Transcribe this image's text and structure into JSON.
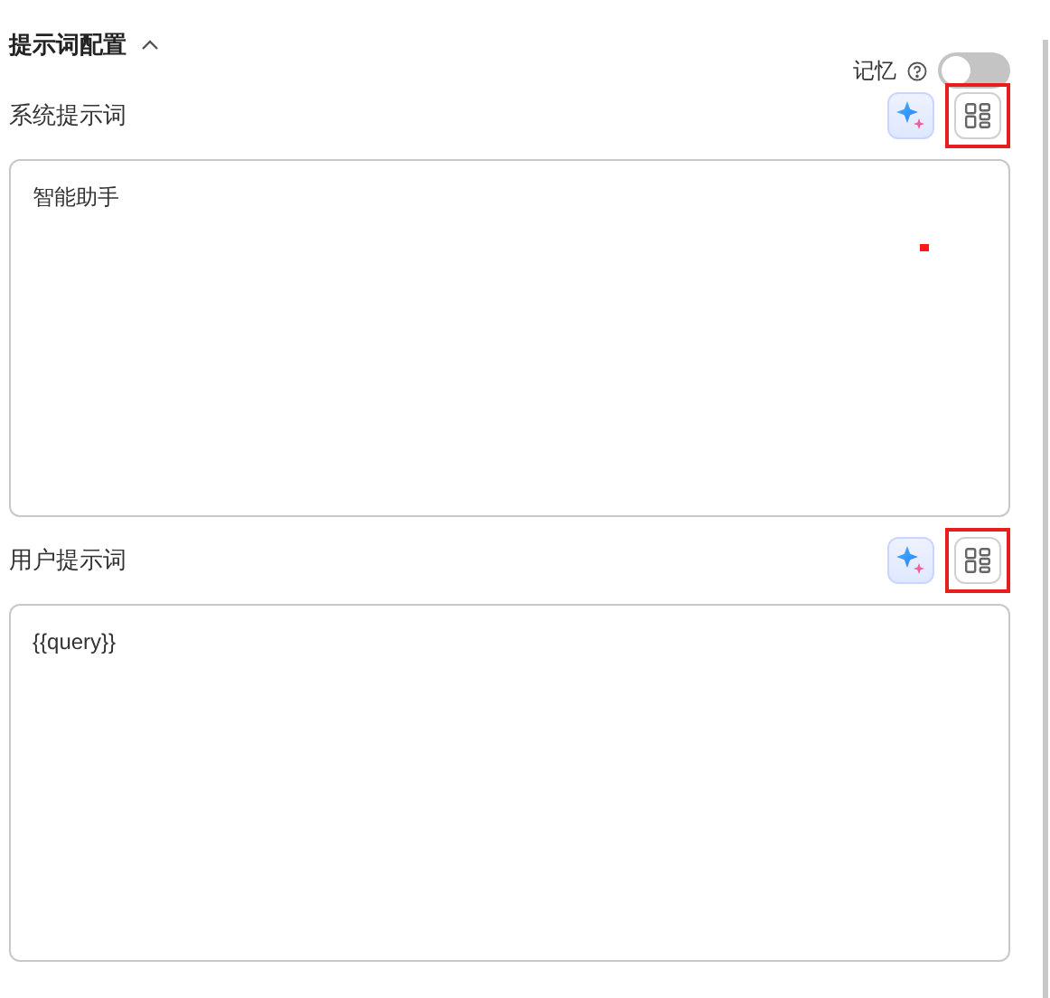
{
  "section": {
    "title": "提示词配置",
    "expanded": true
  },
  "memory": {
    "label": "记忆",
    "on": false
  },
  "prompts": [
    {
      "label": "系统提示词",
      "value": "智能助手",
      "highlighted": true,
      "marker": true
    },
    {
      "label": "用户提示词",
      "value": "{{query}}",
      "highlighted": true,
      "marker": false
    }
  ]
}
